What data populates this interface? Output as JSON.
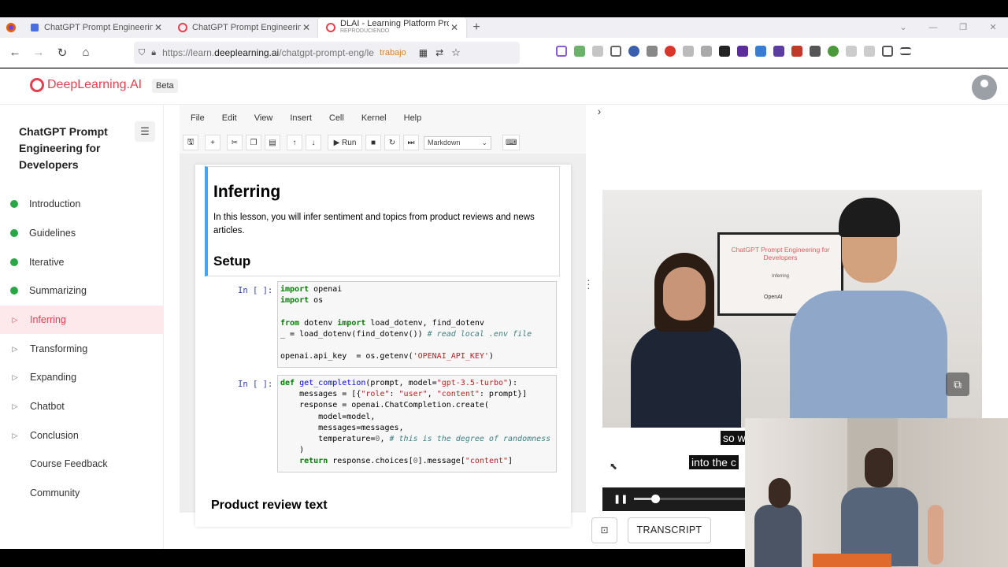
{
  "browser": {
    "tabs": [
      {
        "title": "ChatGPT Prompt Engineering fo",
        "favicon_color": "#4a6ee0"
      },
      {
        "title": "ChatGPT Prompt Engineering fo",
        "favicon_color": "#e6404f"
      },
      {
        "title": "DLAI - Learning Platform Proto",
        "subtitle": "REPRODUCIENDO",
        "favicon_color": "#e6404f"
      }
    ],
    "newtab": "+",
    "url_prefix": "https://learn.",
    "url_domain": "deeplearning.ai",
    "url_path": "/chatgpt-prompt-eng/le",
    "url_tag": "trabajo"
  },
  "site": {
    "logo": "DeepLearning.AI",
    "beta": "Beta",
    "accent": "#e6404f"
  },
  "sidebar": {
    "course_title": "ChatGPT Prompt Engineering for Developers",
    "items": [
      {
        "label": "Introduction",
        "state": "done"
      },
      {
        "label": "Guidelines",
        "state": "done"
      },
      {
        "label": "Iterative",
        "state": "done"
      },
      {
        "label": "Summarizing",
        "state": "done"
      },
      {
        "label": "Inferring",
        "state": "active"
      },
      {
        "label": "Transforming",
        "state": "todo"
      },
      {
        "label": "Expanding",
        "state": "todo"
      },
      {
        "label": "Chatbot",
        "state": "todo"
      },
      {
        "label": "Conclusion",
        "state": "todo"
      },
      {
        "label": "Course Feedback",
        "state": "plain"
      },
      {
        "label": "Community",
        "state": "plain"
      }
    ]
  },
  "notebook": {
    "menu": [
      "File",
      "Edit",
      "View",
      "Insert",
      "Cell",
      "Kernel",
      "Help"
    ],
    "run_label": "Run",
    "cell_type": "Markdown",
    "heading": "Inferring",
    "intro": "In this lesson, you will infer sentiment and topics from product reviews and news articles.",
    "setup": "Setup",
    "prompt1": "In [ ]:",
    "prompt2": "In [ ]:",
    "next_heading": "Product review text"
  },
  "video": {
    "screen_title": "ChatGPT Prompt Engineering for Developers",
    "screen_subtitle": "Inferring",
    "screen_brand": "OpenAI",
    "caption1": "so w",
    "caption2": "into the c",
    "progress": 0.19
  },
  "transcript_label": "TRANSCRIPT"
}
